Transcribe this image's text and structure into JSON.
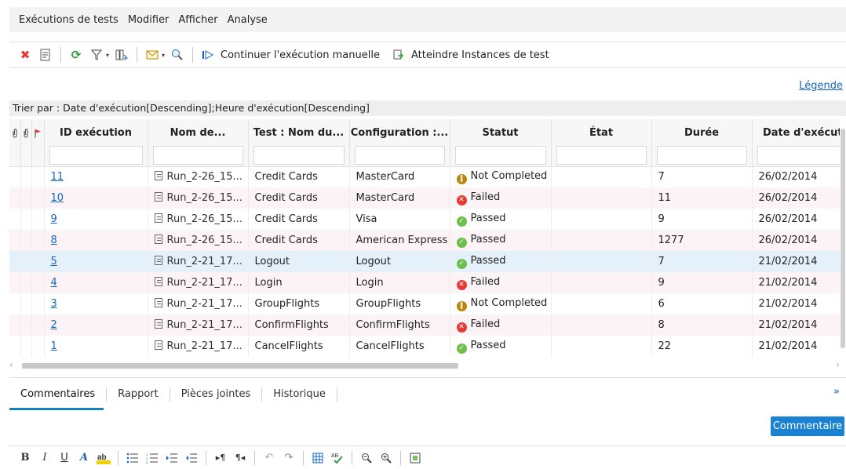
{
  "menubar": {
    "items": [
      "Exécutions de tests",
      "Modifier",
      "Afficher",
      "Analyse"
    ]
  },
  "toolbar": {
    "continue_label": "Continuer l'exécution manuelle",
    "goto_label": "Atteindre Instances de test"
  },
  "legend_link": "Légende",
  "sort_text": "Trier par : Date d'exécution[Descending];Heure d'exécution[Descending]",
  "grid": {
    "columns": [
      "ID exécution",
      "Nom de...",
      "Test : Nom du...",
      "Configuration :...",
      "Statut",
      "État",
      "Durée",
      "Date d'exécuti"
    ],
    "rows": [
      {
        "id": "11",
        "name": "Run_2-26_15...",
        "test": "Credit Cards",
        "config": "MasterCard",
        "status": "Not Completed",
        "status_type": "notcompleted",
        "state": "",
        "duration": "7",
        "date": "26/02/2014"
      },
      {
        "id": "10",
        "name": "Run_2-26_15...",
        "test": "Credit Cards",
        "config": "MasterCard",
        "status": "Failed",
        "status_type": "failed",
        "state": "",
        "duration": "11",
        "date": "26/02/2014"
      },
      {
        "id": "9",
        "name": "Run_2-26_15...",
        "test": "Credit Cards",
        "config": "Visa",
        "status": "Passed",
        "status_type": "passed",
        "state": "",
        "duration": "9",
        "date": "26/02/2014"
      },
      {
        "id": "8",
        "name": "Run_2-26_15...",
        "test": "Credit Cards",
        "config": "American Express",
        "status": "Passed",
        "status_type": "passed",
        "state": "",
        "duration": "1277",
        "date": "26/02/2014"
      },
      {
        "id": "5",
        "name": "Run_2-21_17...",
        "test": "Logout",
        "config": "Logout",
        "status": "Passed",
        "status_type": "passed",
        "state": "",
        "duration": "7",
        "date": "21/02/2014"
      },
      {
        "id": "4",
        "name": "Run_2-21_17...",
        "test": "Login",
        "config": "Login",
        "status": "Failed",
        "status_type": "failed",
        "state": "",
        "duration": "9",
        "date": "21/02/2014"
      },
      {
        "id": "3",
        "name": "Run_2-21_17...",
        "test": "GroupFlights",
        "config": "GroupFlights",
        "status": "Not Completed",
        "status_type": "notcompleted",
        "state": "",
        "duration": "6",
        "date": "21/02/2014"
      },
      {
        "id": "2",
        "name": "Run_2-21_17...",
        "test": "ConfirmFlights",
        "config": "ConfirmFlights",
        "status": "Failed",
        "status_type": "failed",
        "state": "",
        "duration": "8",
        "date": "21/02/2014"
      },
      {
        "id": "1",
        "name": "Run_2-21_17...",
        "test": "CancelFlights",
        "config": "CancelFlights",
        "status": "Passed",
        "status_type": "passed",
        "state": "",
        "duration": "22",
        "date": "21/02/2014"
      }
    ]
  },
  "tabs": [
    "Commentaires",
    "Rapport",
    "Pièces jointes",
    "Historique"
  ],
  "comment_button": "Commentaire",
  "colors": {
    "accent": "#1b82d1",
    "link": "#1565c0",
    "passed": "#6cbf4a",
    "failed": "#e53935",
    "not_completed": "#b8860b",
    "selected_row": "#e4f1fb"
  }
}
